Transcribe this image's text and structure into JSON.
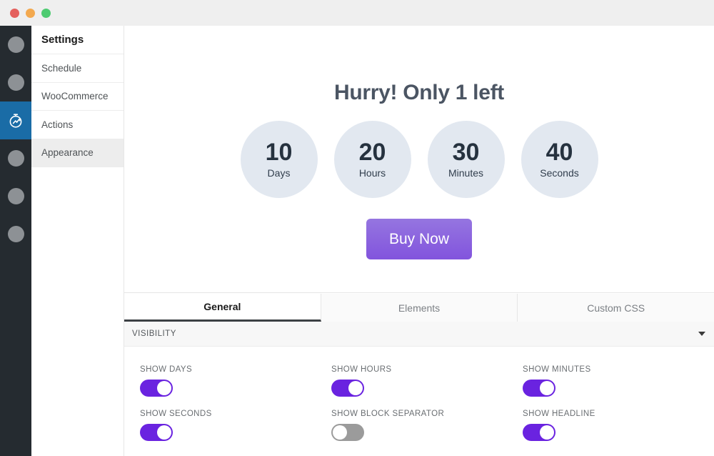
{
  "window": {
    "lights": [
      "close",
      "minimize",
      "zoom"
    ]
  },
  "rail": {
    "items": [
      {
        "icon": "circle-placeholder-icon",
        "active": false
      },
      {
        "icon": "circle-placeholder-icon",
        "active": false
      },
      {
        "icon": "stopwatch-icon",
        "active": true
      },
      {
        "icon": "circle-placeholder-icon",
        "active": false
      },
      {
        "icon": "circle-placeholder-icon",
        "active": false
      },
      {
        "icon": "circle-placeholder-icon",
        "active": false
      }
    ],
    "active_color": "#1a6ca6",
    "background": "#252b30"
  },
  "nav": {
    "title": "Settings",
    "items": [
      {
        "label": "Schedule",
        "active": false
      },
      {
        "label": "WooCommerce",
        "active": false
      },
      {
        "label": "Actions",
        "active": false
      },
      {
        "label": "Appearance",
        "active": true
      }
    ]
  },
  "preview": {
    "headline": "Hurry! Only 1 left",
    "headline_color": "#4b5563",
    "circle_color": "#e2e8f0",
    "units": [
      {
        "value": "10",
        "label": "Days"
      },
      {
        "value": "20",
        "label": "Hours"
      },
      {
        "value": "30",
        "label": "Minutes"
      },
      {
        "value": "40",
        "label": "Seconds"
      }
    ],
    "button": {
      "label": "Buy Now",
      "color": "#8254dd"
    }
  },
  "tabs": [
    {
      "label": "General",
      "active": true
    },
    {
      "label": "Elements",
      "active": false
    },
    {
      "label": "Custom CSS",
      "active": false
    }
  ],
  "section": {
    "title": "VISIBILITY",
    "collapse_icon": "chevron-down-icon",
    "expanded": true
  },
  "toggles": [
    {
      "label": "SHOW DAYS",
      "on": true
    },
    {
      "label": "SHOW HOURS",
      "on": true
    },
    {
      "label": "SHOW MINUTES",
      "on": true
    },
    {
      "label": "SHOW SECONDS",
      "on": true
    },
    {
      "label": "SHOW BLOCK SEPARATOR",
      "on": false
    },
    {
      "label": "SHOW HEADLINE",
      "on": true
    }
  ],
  "colors": {
    "toggle_on": "#6a23e0",
    "toggle_off": "#9b9b9b",
    "accent_blue": "#1a6ca6",
    "accent_purple": "#8254dd"
  }
}
